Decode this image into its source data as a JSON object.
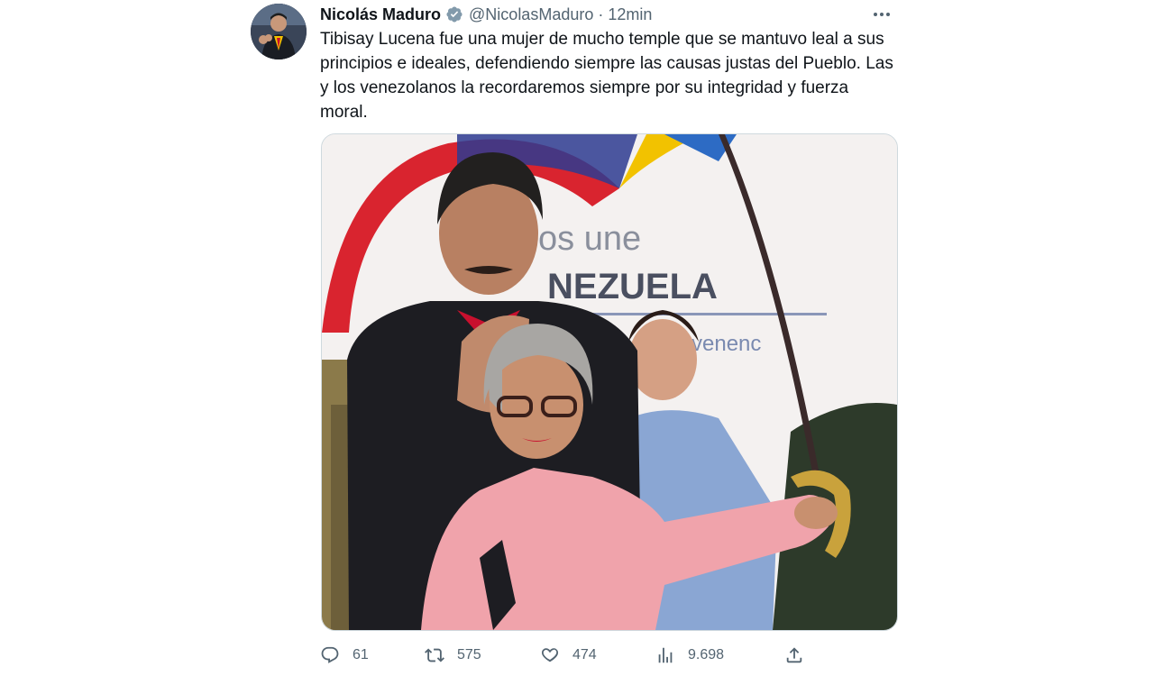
{
  "tweet": {
    "author": {
      "display_name": "Nicolás Maduro",
      "handle": "@NicolasMaduro",
      "verified": true,
      "avatar_icon": "avatar-photo"
    },
    "separator": "·",
    "timestamp": "12min",
    "more_icon": "more-dots-icon",
    "text": "Tibisay Lucena fue una mujer de mucho temple que se mantuvo leal a sus principios e ideales, defendiendo siempre las causas justas del Pueblo. Las y los venezolanos la recordaremos siempre por su integridad y fuerza moral.",
    "media": {
      "description_icon": "photo",
      "banner_text": [
        "os une",
        "NEZUELA",
        "venenc"
      ]
    },
    "actions": {
      "reply": {
        "icon": "reply-icon",
        "count": "61"
      },
      "retweet": {
        "icon": "retweet-icon",
        "count": "575"
      },
      "like": {
        "icon": "heart-icon",
        "count": "474"
      },
      "views": {
        "icon": "views-icon",
        "count": "9.698"
      },
      "share": {
        "icon": "share-icon"
      }
    }
  },
  "colors": {
    "text_primary": "#0f1419",
    "text_secondary": "#536471",
    "verified_badge": "#829aab",
    "border": "#cfd9de"
  }
}
